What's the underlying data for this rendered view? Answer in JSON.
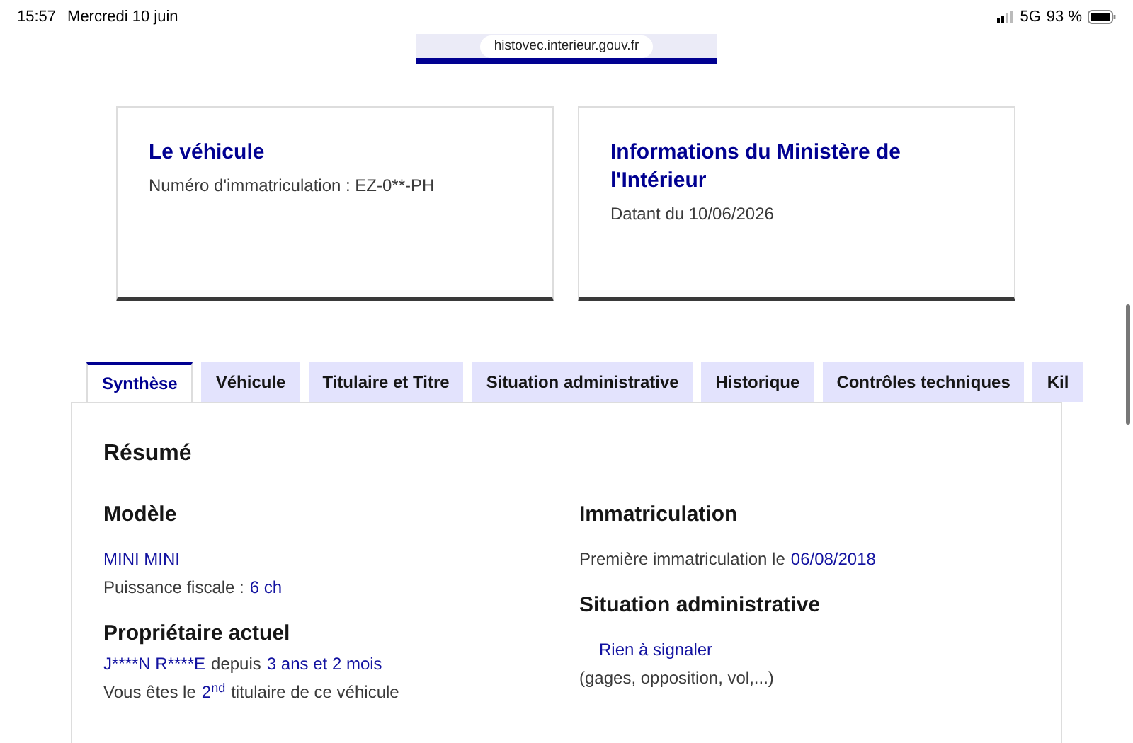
{
  "status_bar": {
    "time": "15:57",
    "date": "Mercredi 10 juin",
    "network": "5G",
    "battery": "93 %"
  },
  "address_bar": {
    "url": "histovec.interieur.gouv.fr"
  },
  "cards": [
    {
      "title": "Le véhicule",
      "text": "Numéro d'immatriculation : EZ-0**-PH"
    },
    {
      "title": "Informations du Ministère de l'Intérieur",
      "text": "Datant du 10/06/2026"
    }
  ],
  "tabs": [
    {
      "label": "Synthèse",
      "selected": true
    },
    {
      "label": "Véhicule",
      "selected": false
    },
    {
      "label": "Titulaire et Titre",
      "selected": false
    },
    {
      "label": "Situation administrative",
      "selected": false
    },
    {
      "label": "Historique",
      "selected": false
    },
    {
      "label": "Contrôles techniques",
      "selected": false
    },
    {
      "label": "Kil",
      "selected": false
    }
  ],
  "panel": {
    "title": "Résumé",
    "columns": [
      {
        "sections": [
          {
            "heading": "Modèle",
            "lines": [
              [
                {
                  "kind": "value",
                  "text": "MINI MINI"
                }
              ],
              [
                {
                  "kind": "plain",
                  "text": "Puissance fiscale :"
                },
                {
                  "kind": "value",
                  "text": "6 ch"
                }
              ]
            ]
          },
          {
            "heading": "Propriétaire actuel",
            "lines": [
              [
                {
                  "kind": "value",
                  "text": "J****N R****E"
                },
                {
                  "kind": "plain",
                  "text": "depuis"
                },
                {
                  "kind": "value",
                  "text": "3 ans et 2 mois"
                }
              ],
              [
                {
                  "kind": "plain",
                  "text": "Vous êtes le"
                },
                {
                  "kind": "ordinal",
                  "text": "2$^{nd}$"
                },
                {
                  "kind": "plain",
                  "text": "titulaire de ce véhicule"
                }
              ]
            ]
          }
        ]
      },
      {
        "sections": [
          {
            "heading": "Immatriculation",
            "lines": [
              [
                {
                  "kind": "plain",
                  "text": "Première immatriculation le"
                },
                {
                  "kind": "value",
                  "text": "06/08/2018"
                }
              ]
            ]
          },
          {
            "heading": "Situation administrative",
            "lines": [
              [
                {
                  "kind": "indented_value",
                  "text": "Rien à signaler"
                }
              ],
              [
                {
                  "kind": "plain",
                  "text": "(gages, opposition, vol,...)"
                }
              ]
            ]
          }
        ]
      }
    ]
  }
}
